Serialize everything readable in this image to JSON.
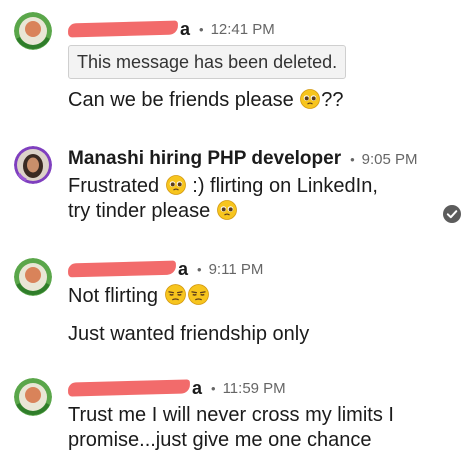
{
  "messages": [
    {
      "sender_suffix": "a",
      "separator": "•",
      "time": "12:41 PM",
      "deleted_text": "This message has been deleted.",
      "text_before_emoji": "Can we be friends please ",
      "emoji": "pleading-face",
      "text_after_emoji": "??"
    },
    {
      "sender": "Manashi hiring PHP developer",
      "separator": "•",
      "time": "9:05 PM",
      "line1_before_emoji": "Frustrated ",
      "line1_emoji": "pleading-face",
      "line1_after_emoji": " :)  flirting on LinkedIn,",
      "line2_before_emoji": "try tinder please ",
      "line2_emoji": "pleading-face",
      "read_indicator": "check-circle-icon"
    },
    {
      "sender_suffix": "a",
      "separator": "•",
      "time": "9:11 PM",
      "line1_text": "Not flirting ",
      "line1_emojis": [
        "unamused-face",
        "unamused-face"
      ],
      "line2_text": "Just wanted friendship only"
    },
    {
      "sender_suffix": "a",
      "separator": "•",
      "time": "11:59 PM",
      "line1_text": "Trust me I will never cross my limits I",
      "line2_text": "promise...just give me one chance"
    }
  ],
  "colors": {
    "redaction": "#f26b6b",
    "emoji_yellow": "#f7c51e",
    "text": "#1b1b1b",
    "meta": "#666666"
  }
}
